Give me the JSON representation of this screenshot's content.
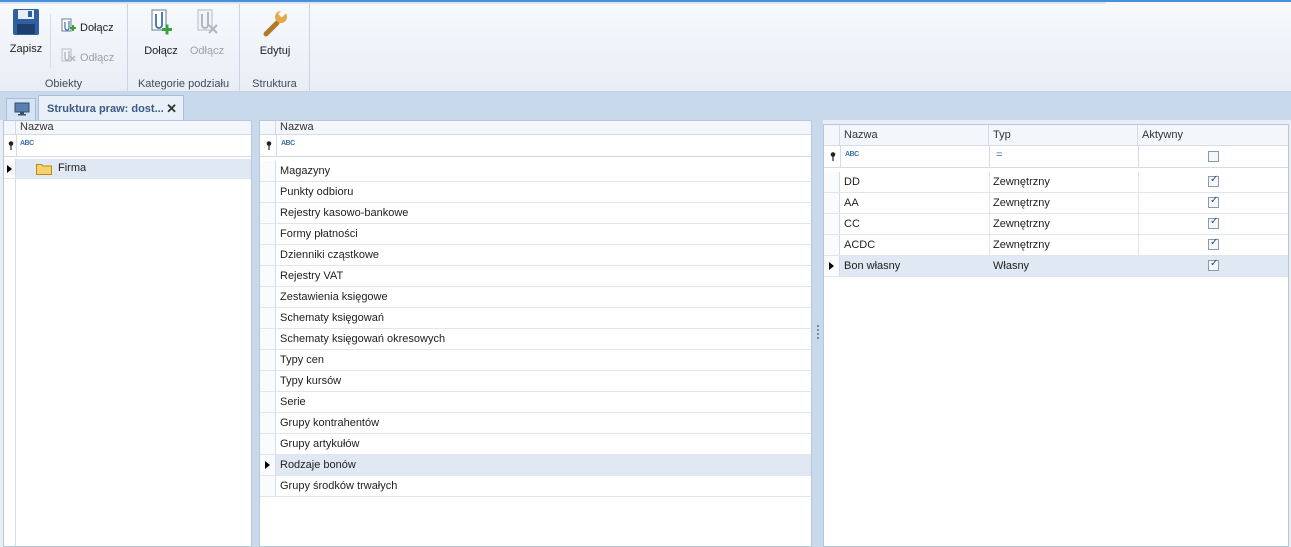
{
  "ribbon": {
    "groups": {
      "obiekty": {
        "label": "Obiekty",
        "save_label": "Zapisz",
        "attach_label": "Dołącz",
        "detach_label": "Odłącz"
      },
      "kategorie": {
        "label": "Kategorie podziału",
        "attach_label": "Dołącz",
        "detach_label": "Odłącz"
      },
      "struktura": {
        "label": "Struktura",
        "edit_label": "Edytuj"
      }
    }
  },
  "tabs": {
    "active_title": "Struktura praw: dost...",
    "close_glyph": "✕"
  },
  "left_panel": {
    "header": "Nazwa",
    "filter_glyph": "ABC",
    "items": [
      {
        "label": "Firma"
      }
    ]
  },
  "middle_panel": {
    "header": "Nazwa",
    "filter_glyph": "ABC",
    "items": [
      "Magazyny",
      "Punkty odbioru",
      "Rejestry kasowo-bankowe",
      "Formy płatności",
      "Dzienniki cząstkowe",
      "Rejestry VAT",
      "Zestawienia księgowe",
      "Schematy księgowań",
      "Schematy księgowań okresowych",
      "Typy cen",
      "Typy kursów",
      "Serie",
      "Grupy kontrahentów",
      "Grupy artykułów",
      "Rodzaje bonów",
      "Grupy środków trwałych"
    ],
    "selected_index": 14
  },
  "right_panel": {
    "headers": [
      "Nazwa",
      "Typ",
      "Aktywny"
    ],
    "filter_glyph": "ABC",
    "filter_eq": "=",
    "rows": [
      {
        "name": "DD",
        "type": "Zewnętrzny",
        "active": true
      },
      {
        "name": "AA",
        "type": "Zewnętrzny",
        "active": true
      },
      {
        "name": "CC",
        "type": "Zewnętrzny",
        "active": true
      },
      {
        "name": "ACDC",
        "type": "Zewnętrzny",
        "active": true
      },
      {
        "name": "Bon własny",
        "type": "Własny",
        "active": true
      }
    ],
    "selected_index": 4
  },
  "colors": {
    "accent": "#4a90d9",
    "selection": "#dfe8f3",
    "tab_text": "#3c5a84"
  }
}
